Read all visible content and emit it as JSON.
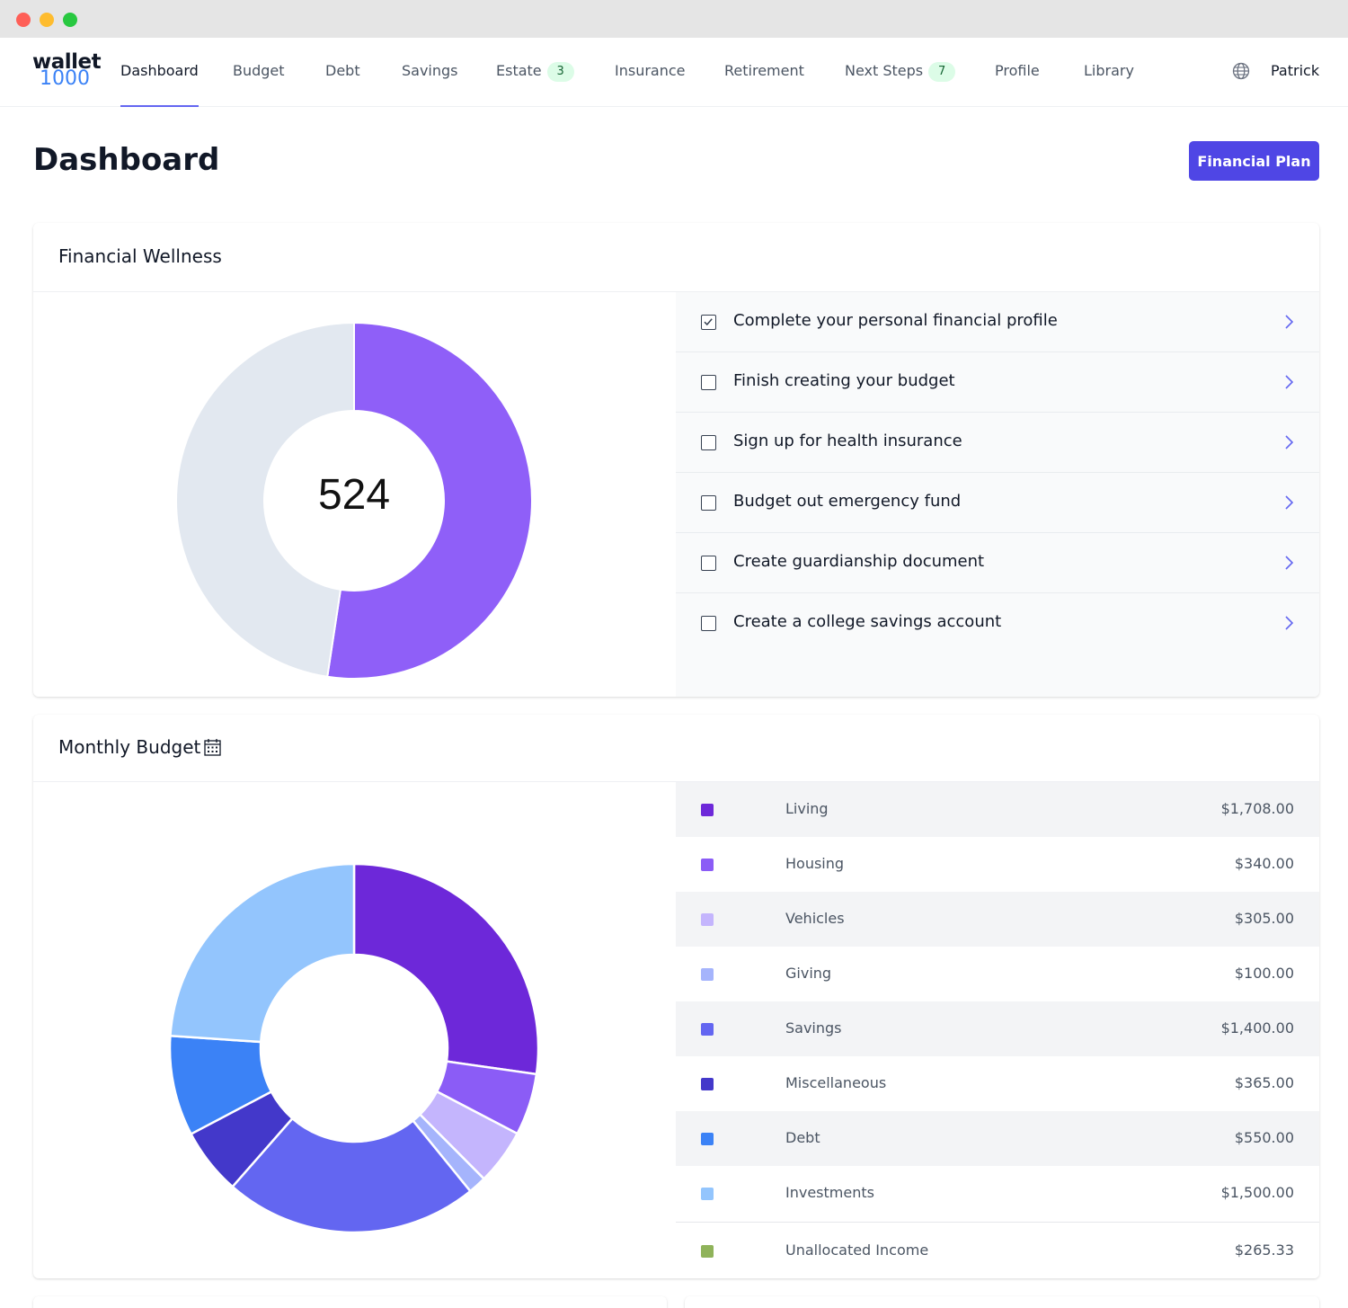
{
  "window": {
    "controls": [
      "close",
      "minimize",
      "maximize"
    ]
  },
  "logo": {
    "line1": "wallet",
    "line2": "1000"
  },
  "nav": {
    "items": [
      {
        "label": "Dashboard",
        "active": true
      },
      {
        "label": "Budget"
      },
      {
        "label": "Debt"
      },
      {
        "label": "Savings"
      },
      {
        "label": "Estate",
        "badge": "3"
      },
      {
        "label": "Insurance"
      },
      {
        "label": "Retirement"
      },
      {
        "label": "Next Steps",
        "badge": "7"
      },
      {
        "label": "Profile"
      },
      {
        "label": "Library"
      }
    ],
    "globe_icon": "globe-icon",
    "user": "Patrick"
  },
  "page": {
    "title": "Dashboard",
    "primary_button": "Financial Plan"
  },
  "wellness": {
    "title": "Financial Wellness",
    "score": "524",
    "score_fraction": 0.524,
    "colors": {
      "fill": "#8f5ff8",
      "track": "#e2e8f0"
    },
    "tasks": [
      {
        "label": "Complete your personal financial profile",
        "checked": true
      },
      {
        "label": "Finish creating your budget",
        "checked": false
      },
      {
        "label": "Sign up for health insurance",
        "checked": false
      },
      {
        "label": "Budget out emergency fund",
        "checked": false
      },
      {
        "label": "Create guardianship document",
        "checked": false
      },
      {
        "label": "Create a college savings account",
        "checked": false
      }
    ]
  },
  "budget": {
    "title": "Monthly Budget",
    "calendar_icon": "calendar-icon",
    "items": [
      {
        "label": "Living",
        "amount": "$1,708.00",
        "value": 1708,
        "color": "#6d28d9"
      },
      {
        "label": "Housing",
        "amount": "$340.00",
        "value": 340,
        "color": "#8b5cf6"
      },
      {
        "label": "Vehicles",
        "amount": "$305.00",
        "value": 305,
        "color": "#c4b5fd"
      },
      {
        "label": "Giving",
        "amount": "$100.00",
        "value": 100,
        "color": "#a5b4fc"
      },
      {
        "label": "Savings",
        "amount": "$1,400.00",
        "value": 1400,
        "color": "#6366f1"
      },
      {
        "label": "Miscellaneous",
        "amount": "$365.00",
        "value": 365,
        "color": "#4338ca"
      },
      {
        "label": "Debt",
        "amount": "$550.00",
        "value": 550,
        "color": "#3b82f6"
      },
      {
        "label": "Investments",
        "amount": "$1,500.00",
        "value": 1500,
        "color": "#93c5fd"
      }
    ],
    "unallocated": {
      "label": "Unallocated Income",
      "amount": "$265.33",
      "color": "#8fb35a"
    }
  },
  "chart_data": [
    {
      "type": "pie",
      "variant": "donut",
      "center_label": "524",
      "values": [
        52.4,
        47.6
      ]
    },
    {
      "type": "pie",
      "variant": "donut",
      "categories": [
        "Living",
        "Housing",
        "Vehicles",
        "Giving",
        "Savings",
        "Miscellaneous",
        "Debt",
        "Investments"
      ],
      "values": [
        1708,
        340,
        305,
        100,
        1400,
        365,
        550,
        1500
      ]
    }
  ]
}
